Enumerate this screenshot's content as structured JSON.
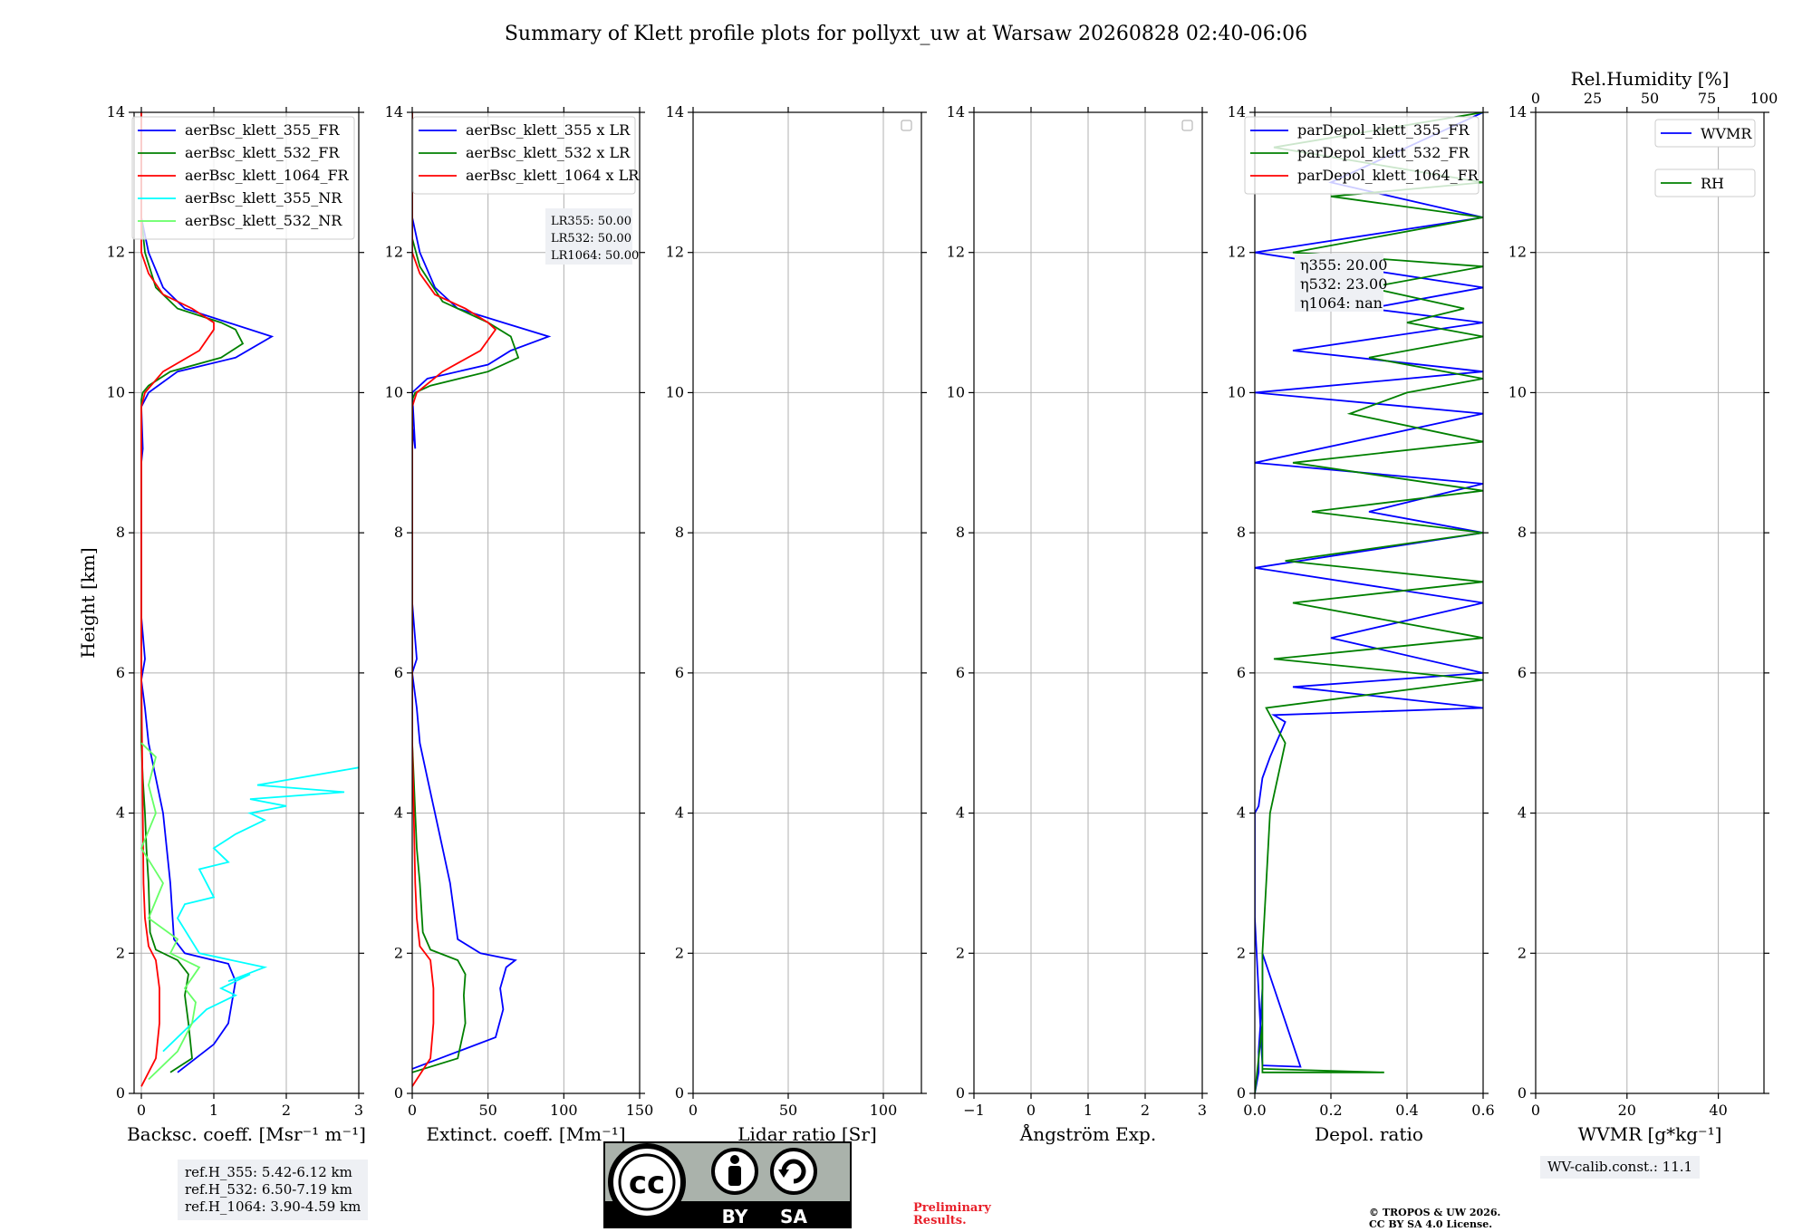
{
  "title": "Summary of Klett profile plots for pollyxt_uw at Warsaw 20260828 02:40-06:06",
  "chart_data": [
    {
      "id": "backscatter",
      "type": "line",
      "xlabel": "Backsc. coeff. [Msr⁻¹ m⁻¹]",
      "ylabel": "Height [km]",
      "xlim": [
        -0.1,
        3
      ],
      "xticks": [
        0,
        1,
        2,
        3
      ],
      "ylim": [
        0,
        14
      ],
      "yticks": [
        0,
        2,
        4,
        6,
        8,
        10,
        12,
        14
      ],
      "grid": true,
      "legend_position": "top-right",
      "series": [
        {
          "name": "aerBsc_klett_355_FR",
          "color": "#0000ff",
          "x": [
            0.5,
            1.0,
            1.2,
            1.25,
            1.3,
            1.2,
            0.6,
            0.45,
            0.4,
            0.35,
            0.3,
            0.2,
            0.1,
            0.05,
            0.0,
            0.05,
            0.0,
            0.0,
            0.0,
            0.0,
            0.0,
            0.02,
            0.0,
            0.1,
            0.5,
            1.3,
            1.8,
            1.2,
            0.6,
            0.3,
            0.1,
            0.0,
            0.0,
            0.0
          ],
          "y": [
            0.3,
            0.7,
            1.0,
            1.3,
            1.6,
            1.85,
            2.0,
            2.2,
            3.0,
            3.5,
            4.0,
            4.5,
            5.0,
            5.5,
            5.9,
            6.2,
            6.8,
            7.5,
            8.0,
            8.5,
            9.0,
            9.2,
            9.8,
            10.0,
            10.3,
            10.5,
            10.8,
            11.0,
            11.2,
            11.5,
            12.0,
            12.5,
            13.0,
            14.0
          ]
        },
        {
          "name": "aerBsc_klett_532_FR",
          "color": "#008000",
          "x": [
            0.4,
            0.7,
            0.65,
            0.6,
            0.65,
            0.5,
            0.2,
            0.12,
            0.1,
            0.07,
            0.05,
            0.02,
            0.0,
            0.0,
            0.0,
            0.0,
            0.0,
            0.0,
            0.0,
            0.02,
            0.1,
            0.4,
            1.1,
            1.4,
            1.3,
            1.1,
            0.5,
            0.2,
            0.05,
            0.0,
            0.0
          ],
          "y": [
            0.3,
            0.5,
            1.0,
            1.4,
            1.7,
            1.9,
            2.05,
            2.3,
            3.0,
            3.5,
            4.0,
            4.5,
            5.0,
            6.0,
            7.0,
            8.0,
            9.0,
            9.7,
            9.9,
            10.0,
            10.1,
            10.3,
            10.5,
            10.7,
            10.9,
            11.0,
            11.2,
            11.5,
            12.0,
            12.5,
            14.0
          ]
        },
        {
          "name": "aerBsc_klett_1064_FR",
          "color": "#ff0000",
          "x": [
            0.0,
            0.2,
            0.25,
            0.25,
            0.2,
            0.1,
            0.05,
            0.03,
            0.02,
            0.01,
            0.0,
            0.0,
            0.0,
            0.0,
            0.0,
            0.05,
            0.3,
            0.8,
            1.0,
            1.0,
            0.7,
            0.3,
            0.1,
            0.0,
            0.0
          ],
          "y": [
            0.1,
            0.5,
            1.0,
            1.5,
            1.9,
            2.1,
            2.5,
            3.0,
            4.0,
            5.0,
            6.0,
            7.0,
            8.0,
            9.0,
            9.8,
            10.0,
            10.3,
            10.6,
            10.9,
            11.0,
            11.2,
            11.4,
            11.7,
            12.0,
            14.0
          ]
        },
        {
          "name": "aerBsc_klett_355_NR",
          "color": "#00ffff",
          "x": [
            0.3,
            0.6,
            0.9,
            1.3,
            1.1,
            1.5,
            1.2,
            1.7,
            0.8,
            0.5,
            0.6,
            1.0,
            0.9,
            0.8,
            1.2,
            1.0,
            1.3,
            1.7,
            1.5,
            2.0,
            1.5,
            2.8,
            1.6,
            3.0
          ],
          "y": [
            0.6,
            0.9,
            1.2,
            1.4,
            1.5,
            1.7,
            1.6,
            1.8,
            2.0,
            2.5,
            2.7,
            2.8,
            3.0,
            3.2,
            3.3,
            3.5,
            3.7,
            3.9,
            4.0,
            4.1,
            4.2,
            4.3,
            4.4,
            4.65
          ]
        },
        {
          "name": "aerBsc_klett_532_NR",
          "color": "#66ff66",
          "x": [
            0.1,
            0.5,
            0.7,
            0.75,
            0.6,
            0.8,
            0.4,
            0.5,
            0.1,
            0.3,
            0.0,
            0.2,
            0.1,
            0.2,
            0.0
          ],
          "y": [
            0.2,
            0.6,
            1.0,
            1.3,
            1.5,
            1.8,
            2.0,
            2.2,
            2.5,
            3.0,
            3.5,
            4.0,
            4.4,
            4.8,
            5.0
          ]
        }
      ],
      "annotation": [
        "ref.H_355: 5.42-6.12 km",
        "ref.H_532: 6.50-7.19 km",
        "ref.H_1064: 3.90-4.59 km"
      ]
    },
    {
      "id": "extinction",
      "type": "line",
      "xlabel": "Extinct. coeff. [Mm⁻¹]",
      "xlim": [
        0,
        150
      ],
      "xticks": [
        0,
        50,
        100,
        150
      ],
      "ylim": [
        0,
        14
      ],
      "yticks": [
        0,
        2,
        4,
        6,
        8,
        10,
        12,
        14
      ],
      "grid": true,
      "legend_position": "top-right",
      "series": [
        {
          "name": "aerBsc_klett_355 x LR",
          "color": "#0000ff",
          "x": [
            0,
            55,
            60,
            58,
            62,
            68,
            45,
            30,
            25,
            20,
            15,
            10,
            5,
            3,
            0,
            3,
            0,
            0,
            0,
            0,
            0,
            2,
            0,
            10,
            50,
            65,
            90,
            60,
            30,
            15,
            5,
            0,
            0
          ],
          "y": [
            0.35,
            0.8,
            1.2,
            1.5,
            1.8,
            1.9,
            2.0,
            2.2,
            3.0,
            3.5,
            4.0,
            4.5,
            5.0,
            5.5,
            6.0,
            6.2,
            7.0,
            8.0,
            8.5,
            9.0,
            9.5,
            9.2,
            10.0,
            10.2,
            10.4,
            10.6,
            10.8,
            11.0,
            11.2,
            11.5,
            12.0,
            12.5,
            14.0
          ]
        },
        {
          "name": "aerBsc_klett_532 x LR",
          "color": "#008000",
          "x": [
            0,
            30,
            35,
            34,
            35,
            30,
            12,
            7,
            5,
            3,
            2,
            1,
            0,
            0,
            0,
            0,
            0,
            0,
            0,
            2,
            12,
            50,
            70,
            65,
            50,
            20,
            5,
            0,
            0
          ],
          "y": [
            0.3,
            0.5,
            1.0,
            1.4,
            1.7,
            1.9,
            2.05,
            2.3,
            3.0,
            3.5,
            4.0,
            4.5,
            5.0,
            6.0,
            7.0,
            8.0,
            9.0,
            9.7,
            9.9,
            10.0,
            10.1,
            10.3,
            10.5,
            10.8,
            11.0,
            11.3,
            11.8,
            12.2,
            14.0
          ]
        },
        {
          "name": "aerBsc_klett_1064 x LR",
          "color": "#ff0000",
          "x": [
            0,
            12,
            14,
            14,
            12,
            5,
            3,
            2,
            1,
            0,
            0,
            0,
            0,
            0,
            0,
            3,
            20,
            45,
            55,
            50,
            35,
            15,
            5,
            0,
            0
          ],
          "y": [
            0.1,
            0.5,
            1.0,
            1.5,
            1.9,
            2.1,
            2.5,
            3.0,
            4.0,
            5.0,
            6.0,
            7.0,
            8.0,
            9.0,
            9.8,
            10.0,
            10.3,
            10.6,
            10.9,
            11.0,
            11.2,
            11.4,
            11.7,
            12.0,
            14.0
          ]
        }
      ],
      "annotation": [
        "LR355: 50.00",
        "LR532: 50.00",
        "LR1064: 50.00"
      ]
    },
    {
      "id": "lidar-ratio",
      "type": "line",
      "xlabel": "Lidar ratio [Sr]",
      "xlim": [
        0,
        120
      ],
      "xticks": [
        0,
        50,
        100
      ],
      "ylim": [
        0,
        14
      ],
      "yticks": [
        0,
        2,
        4,
        6,
        8,
        10,
        12,
        14
      ],
      "grid": true,
      "series": []
    },
    {
      "id": "angstrom",
      "type": "line",
      "xlabel": "Ångström Exp.",
      "xlim": [
        -1,
        3
      ],
      "xticks": [
        -1,
        0,
        1,
        2,
        3
      ],
      "ylim": [
        0,
        14
      ],
      "yticks": [
        0,
        2,
        4,
        6,
        8,
        10,
        12,
        14
      ],
      "grid": true,
      "series": []
    },
    {
      "id": "depol",
      "type": "line",
      "xlabel": "Depol. ratio",
      "xlim": [
        0,
        0.6
      ],
      "xticks": [
        0.0,
        0.2,
        0.4,
        0.6
      ],
      "ylim": [
        0,
        14
      ],
      "yticks": [
        0,
        2,
        4,
        6,
        8,
        10,
        12,
        14
      ],
      "grid": true,
      "legend_position": "top-right",
      "series": [
        {
          "name": "parDepol_klett_355_FR",
          "color": "#0000ff",
          "x": [
            0.0,
            0.01,
            0.01,
            0.015,
            0.02,
            0.02,
            0.12,
            0.02,
            0.0,
            0.0,
            0.0,
            0.0,
            0.01,
            0.02,
            0.04,
            0.08,
            0.05,
            0.6,
            0.1,
            0.6,
            0.2,
            0.6,
            0.0,
            0.6,
            0.3,
            0.6,
            0.0,
            0.6,
            0.0,
            0.6,
            0.1,
            0.6,
            0.3,
            0.6,
            0.0,
            0.6,
            0.2,
            0.6
          ],
          "y": [
            0.0,
            0.3,
            0.6,
            1.0,
            1.5,
            2.0,
            0.38,
            0.4,
            2.5,
            3.0,
            3.5,
            4.0,
            4.1,
            4.5,
            4.8,
            5.3,
            5.4,
            5.5,
            5.8,
            6.0,
            6.5,
            7.0,
            7.5,
            8.0,
            8.3,
            8.7,
            9.0,
            9.7,
            10.0,
            10.3,
            10.6,
            11.0,
            11.2,
            11.5,
            12.0,
            12.5,
            13.0,
            14.0
          ]
        },
        {
          "name": "parDepol_klett_532_FR",
          "color": "#008000",
          "x": [
            0.0,
            0.02,
            0.02,
            0.34,
            0.02,
            0.02,
            0.04,
            0.08,
            0.03,
            0.6,
            0.05,
            0.6,
            0.1,
            0.6,
            0.08,
            0.6,
            0.15,
            0.6,
            0.1,
            0.6,
            0.25,
            0.4,
            0.6,
            0.3,
            0.6,
            0.4,
            0.55,
            0.3,
            0.6,
            0.1,
            0.6,
            0.2,
            0.6,
            0.05,
            0.6
          ],
          "y": [
            0.0,
            1.0,
            0.3,
            0.3,
            0.35,
            2.0,
            4.0,
            5.0,
            5.5,
            5.9,
            6.2,
            6.5,
            7.0,
            7.3,
            7.6,
            8.0,
            8.3,
            8.6,
            9.0,
            9.3,
            9.7,
            10.0,
            10.2,
            10.5,
            10.8,
            11.0,
            11.2,
            11.5,
            11.8,
            12.0,
            12.5,
            12.8,
            13.0,
            13.5,
            14.0
          ]
        },
        {
          "name": "parDepol_klett_1064_FR",
          "color": "#ff0000",
          "x": [],
          "y": []
        }
      ],
      "annotation": [
        "η355: 20.00",
        "η532: 23.00",
        "η1064: nan"
      ]
    },
    {
      "id": "wvmr",
      "type": "line",
      "xlabel": "WVMR [g*kg⁻¹]",
      "xlim": [
        0,
        50
      ],
      "xticks": [
        0,
        20,
        40
      ],
      "x2label": "Rel.Humidity [%]",
      "x2lim": [
        0,
        100
      ],
      "x2ticks": [
        0,
        25,
        50,
        75,
        100
      ],
      "ylim": [
        0,
        14
      ],
      "yticks": [
        0,
        2,
        4,
        6,
        8,
        10,
        12,
        14
      ],
      "grid": true,
      "legend_position": "top-right",
      "series": [
        {
          "name": "WVMR",
          "color": "#0000ff",
          "x": [],
          "y": []
        },
        {
          "name": "RH",
          "color": "#008000",
          "x": [],
          "y": []
        }
      ],
      "annotation": [
        "WV-calib.const.: 11.1"
      ]
    }
  ],
  "footer": {
    "preliminary": [
      "Preliminary",
      "Results."
    ],
    "copyright": [
      "© TROPOS & UW 2026.",
      "CC BY SA 4.0 License."
    ],
    "cc_badge": {
      "by": "BY",
      "sa": "SA",
      "cc": "cc"
    }
  }
}
